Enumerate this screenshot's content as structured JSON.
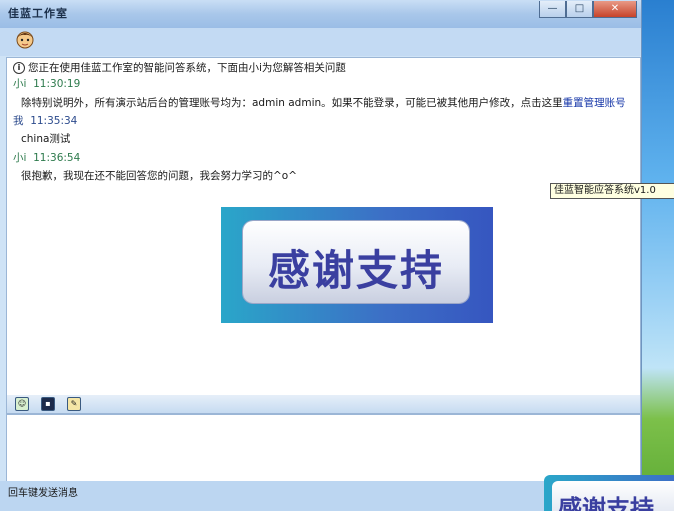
{
  "window": {
    "title": "佳蓝工作室",
    "buttons": {
      "minimize": "—",
      "maximize": "□",
      "close": "✕"
    }
  },
  "chat": {
    "system_notice": "您正在使用佳蓝工作室的智能问答系统，下面由小i为您解答相关问题",
    "messages": [
      {
        "sender": "小i",
        "time": "11:30:19",
        "text_prefix": "除特别说明外，所有演示站后台的管理账号均为：admin admin。如果不能登录，可能已被其他用户修改，点击这里",
        "link": "重置管理账号"
      },
      {
        "sender": "我",
        "time": "11:35:34",
        "text": "china测试"
      },
      {
        "sender": "小i",
        "time": "11:36:54",
        "text": "很抱歉，我现在还不能回答您的问题，我会努力学习的^o^"
      }
    ]
  },
  "banner": {
    "text": "感谢支持"
  },
  "input_toolbar": {
    "icons": [
      "emoticon-icon",
      "save-icon",
      "history-icon"
    ]
  },
  "status": {
    "text": "回车键发送消息"
  },
  "tooltip": {
    "text": "佳蓝智能应答系统v1.0"
  },
  "taskbar_thumbnail": {
    "text": "感谢支持"
  }
}
